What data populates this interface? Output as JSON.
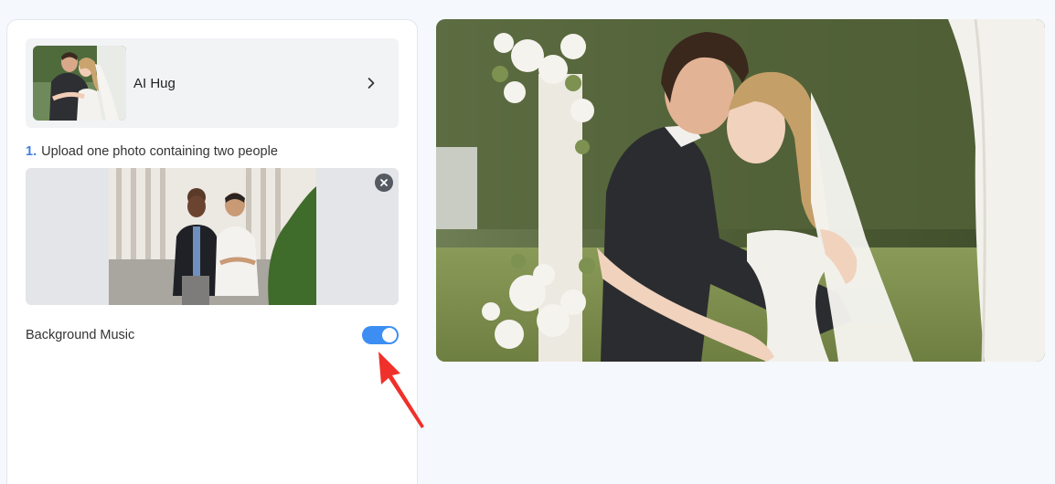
{
  "effect": {
    "name": "AI Hug",
    "chevron_icon": "chevron-right-icon"
  },
  "upload": {
    "step_number": "1.",
    "instruction": "Upload one photo containing two people",
    "remove_icon": "close-circle-icon"
  },
  "music": {
    "label": "Background Music",
    "enabled": true
  },
  "colors": {
    "accent": "#3d8ef2",
    "step_number": "#3d7fe0",
    "annotation_arrow": "#f0302a"
  }
}
